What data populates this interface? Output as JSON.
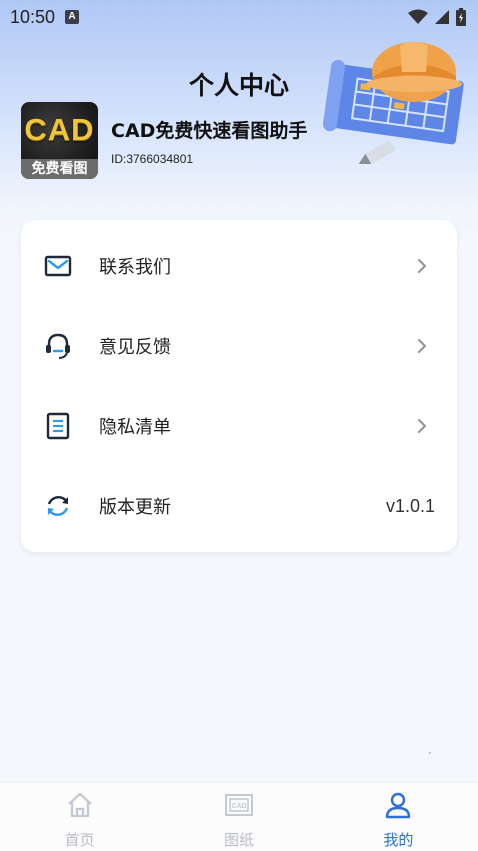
{
  "status_bar": {
    "time": "10:50",
    "notification_badge": "A"
  },
  "header": {
    "title": "个人中心",
    "app_name": "CAD免费快速看图助手",
    "user_id": "ID:3766034801",
    "logo_text": "CAD",
    "logo_subtext": "免费看图"
  },
  "menu": {
    "items": [
      {
        "label": "联系我们",
        "icon": "mail-icon"
      },
      {
        "label": "意见反馈",
        "icon": "headset-icon"
      },
      {
        "label": "隐私清单",
        "icon": "document-icon"
      },
      {
        "label": "版本更新",
        "icon": "refresh-icon",
        "value": "v1.0.1"
      }
    ]
  },
  "tabbar": {
    "tabs": [
      {
        "label": "首页",
        "icon": "home-icon",
        "active": false
      },
      {
        "label": "图纸",
        "icon": "cad-drawing-icon",
        "active": false
      },
      {
        "label": "我的",
        "icon": "profile-icon",
        "active": true
      }
    ]
  },
  "colors": {
    "accent": "#2f6ed8",
    "inactive": "#b8bcc6",
    "card": "#ffffff",
    "background": "#f5f7fc"
  }
}
